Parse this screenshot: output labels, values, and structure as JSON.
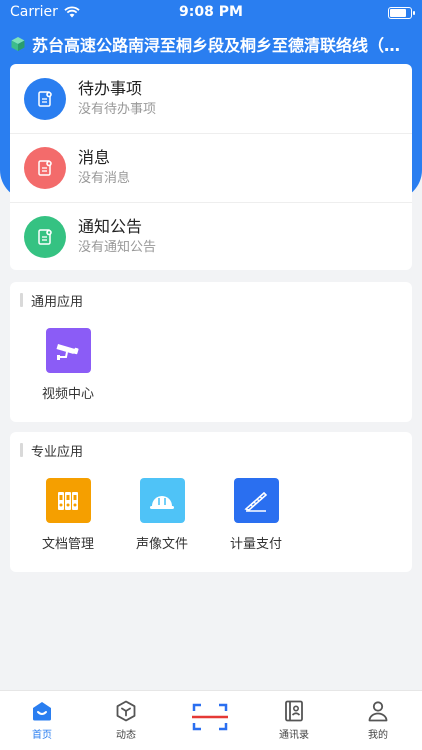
{
  "status_bar": {
    "carrier": "Carrier",
    "time": "9:08 PM",
    "battery_level": 0.9
  },
  "header": {
    "title": "苏台高速公路南浔至桐乡段及桐乡至德清联络线（…"
  },
  "messages": [
    {
      "title": "待办事项",
      "subtitle": "没有待办事项",
      "color": "#2a7ef0",
      "icon": "document-icon"
    },
    {
      "title": "消息",
      "subtitle": "没有消息",
      "color": "#f36b6b",
      "icon": "document-icon"
    },
    {
      "title": "通知公告",
      "subtitle": "没有通知公告",
      "color": "#35c282",
      "icon": "document-icon"
    }
  ],
  "general_apps": {
    "title": "通用应用",
    "items": [
      {
        "label": "视频中心",
        "color": "#8b5cf6",
        "icon": "camera-icon"
      }
    ]
  },
  "professional_apps": {
    "title": "专业应用",
    "items": [
      {
        "label": "文档管理",
        "color": "#f59f00",
        "icon": "binders-icon"
      },
      {
        "label": "声像文件",
        "color": "#4fc3f7",
        "icon": "helmet-icon"
      },
      {
        "label": "计量支付",
        "color": "#2a6ff0",
        "icon": "ruler-icon"
      }
    ]
  },
  "tabbar": {
    "items": [
      {
        "label": "首页",
        "active": true
      },
      {
        "label": "动态",
        "active": false
      },
      {
        "label": "",
        "active": false
      },
      {
        "label": "通讯录",
        "active": false
      },
      {
        "label": "我的",
        "active": false
      }
    ]
  },
  "colors": {
    "primary": "#2a7ef0",
    "scan_accent": "#e53935"
  }
}
